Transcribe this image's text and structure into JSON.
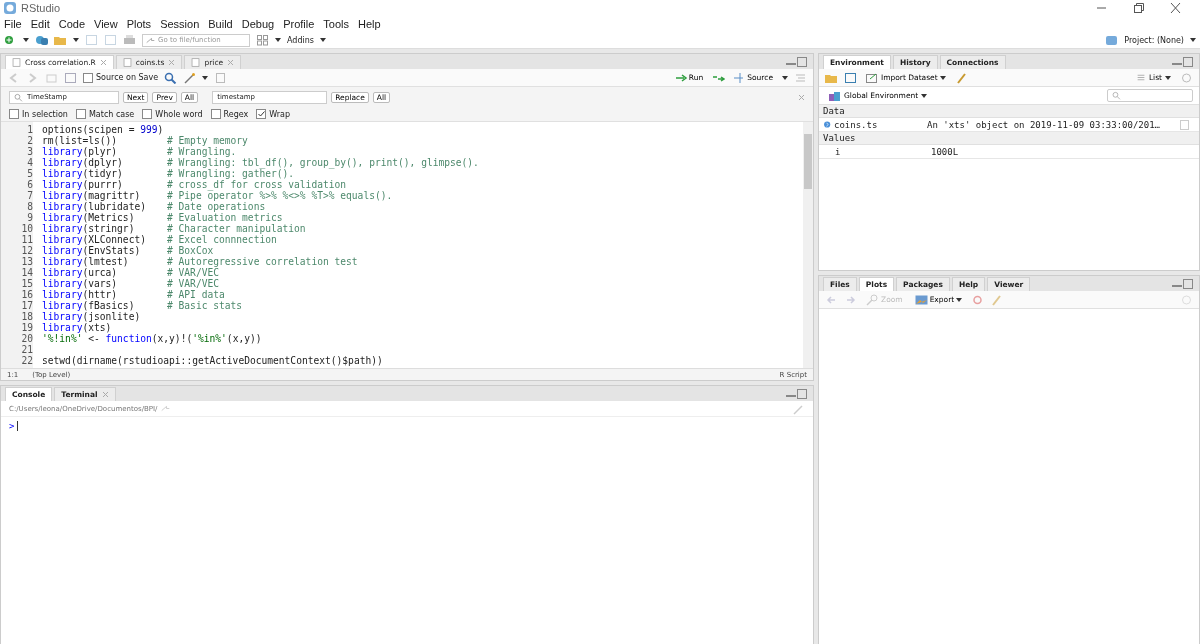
{
  "window": {
    "title": "RStudio"
  },
  "menu": [
    "File",
    "Edit",
    "Code",
    "View",
    "Plots",
    "Session",
    "Build",
    "Debug",
    "Profile",
    "Tools",
    "Help"
  ],
  "toolbar": {
    "goto_placeholder": "Go to file/function",
    "addins": "Addins",
    "project": "Project: (None)"
  },
  "source": {
    "tabs": [
      {
        "label": "Cross correlation.R",
        "selected": true
      },
      {
        "label": "coins.ts",
        "selected": false
      },
      {
        "label": "price",
        "selected": false
      }
    ],
    "source_on_save": {
      "label": "Source on Save",
      "checked": false
    },
    "run": "Run",
    "source_button": "Source",
    "find": {
      "value": "TimeStamp",
      "buttons": [
        "Next",
        "Prev",
        "All"
      ],
      "replace_value": "timestamp",
      "replace_buttons": [
        "Replace",
        "All"
      ]
    },
    "options": [
      {
        "label": "In selection",
        "checked": false
      },
      {
        "label": "Match case",
        "checked": false
      },
      {
        "label": "Whole word",
        "checked": false
      },
      {
        "label": "Regex",
        "checked": false
      },
      {
        "label": "Wrap",
        "checked": true
      }
    ],
    "lines": [
      {
        "number": "1",
        "code": [
          {
            "text": "options(scipen = ",
            "kind": "plain"
          },
          {
            "text": "999",
            "kind": "number"
          },
          {
            "text": ")",
            "kind": "plain"
          }
        ]
      },
      {
        "number": "2",
        "code": [
          {
            "text": "rm(list=ls())",
            "kind": "plain"
          }
        ],
        "comment": "# Empty memory"
      },
      {
        "number": "3",
        "code": [
          {
            "text": "library",
            "kind": "keyword"
          },
          {
            "text": "(plyr)",
            "kind": "plain"
          }
        ],
        "comment": "# Wrangling."
      },
      {
        "number": "4",
        "code": [
          {
            "text": "library",
            "kind": "keyword"
          },
          {
            "text": "(dplyr)",
            "kind": "plain"
          }
        ],
        "comment": "# Wrangling: tbl_df(), group_by(), print(), glimpse()."
      },
      {
        "number": "5",
        "code": [
          {
            "text": "library",
            "kind": "keyword"
          },
          {
            "text": "(tidyr)",
            "kind": "plain"
          }
        ],
        "comment": "# Wrangling: gather()."
      },
      {
        "number": "6",
        "code": [
          {
            "text": "library",
            "kind": "keyword"
          },
          {
            "text": "(purrr)",
            "kind": "plain"
          }
        ],
        "comment": "# cross_df for cross validation"
      },
      {
        "number": "7",
        "code": [
          {
            "text": "library",
            "kind": "keyword"
          },
          {
            "text": "(magrittr)",
            "kind": "plain"
          }
        ],
        "comment": "# Pipe operator %>% %<>% %T>% equals()."
      },
      {
        "number": "8",
        "code": [
          {
            "text": "library",
            "kind": "keyword"
          },
          {
            "text": "(lubridate)",
            "kind": "plain"
          }
        ],
        "comment": "# Date operations"
      },
      {
        "number": "9",
        "code": [
          {
            "text": "library",
            "kind": "keyword"
          },
          {
            "text": "(Metrics)",
            "kind": "plain"
          }
        ],
        "comment": "# Evaluation metrics"
      },
      {
        "number": "10",
        "code": [
          {
            "text": "library",
            "kind": "keyword"
          },
          {
            "text": "(stringr)",
            "kind": "plain"
          }
        ],
        "comment": "# Character manipulation"
      },
      {
        "number": "11",
        "code": [
          {
            "text": "library",
            "kind": "keyword"
          },
          {
            "text": "(XLConnect)",
            "kind": "plain"
          }
        ],
        "comment": "# Excel connnection"
      },
      {
        "number": "12",
        "code": [
          {
            "text": "library",
            "kind": "keyword"
          },
          {
            "text": "(EnvStats)",
            "kind": "plain"
          }
        ],
        "comment": "# BoxCox"
      },
      {
        "number": "13",
        "code": [
          {
            "text": "library",
            "kind": "keyword"
          },
          {
            "text": "(lmtest)",
            "kind": "plain"
          }
        ],
        "comment": "# Autoregressive correlation test"
      },
      {
        "number": "14",
        "code": [
          {
            "text": "library",
            "kind": "keyword"
          },
          {
            "text": "(urca)",
            "kind": "plain"
          }
        ],
        "comment": "# VAR/VEC"
      },
      {
        "number": "15",
        "code": [
          {
            "text": "library",
            "kind": "keyword"
          },
          {
            "text": "(vars)",
            "kind": "plain"
          }
        ],
        "comment": "# VAR/VEC"
      },
      {
        "number": "16",
        "code": [
          {
            "text": "library",
            "kind": "keyword"
          },
          {
            "text": "(httr)",
            "kind": "plain"
          }
        ],
        "comment": "# API data"
      },
      {
        "number": "17",
        "code": [
          {
            "text": "library",
            "kind": "keyword"
          },
          {
            "text": "(fBasics)",
            "kind": "plain"
          }
        ],
        "comment": "# Basic stats"
      },
      {
        "number": "18",
        "code": [
          {
            "text": "library",
            "kind": "keyword"
          },
          {
            "text": "(jsonlite)",
            "kind": "plain"
          }
        ]
      },
      {
        "number": "19",
        "code": [
          {
            "text": "library",
            "kind": "keyword"
          },
          {
            "text": "(xts)",
            "kind": "plain"
          }
        ]
      },
      {
        "number": "20",
        "code": [
          {
            "text": "'%!in%'",
            "kind": "string"
          },
          {
            "text": " <- ",
            "kind": "plain"
          },
          {
            "text": "function",
            "kind": "keyword"
          },
          {
            "text": "(x,y)!(",
            "kind": "plain"
          },
          {
            "text": "'%in%'",
            "kind": "string"
          },
          {
            "text": "(x,y))",
            "kind": "plain"
          }
        ]
      },
      {
        "number": "21"
      },
      {
        "number": "22",
        "code": [
          {
            "text": "setwd(dirname(rstudioapi::getActiveDocumentContext()$path))",
            "kind": "plain"
          }
        ]
      }
    ],
    "status": {
      "position": "1:1",
      "scope": "(Top Level)",
      "filetype": "R Script"
    }
  },
  "console": {
    "tabs": [
      {
        "label": "Console",
        "selected": true
      },
      {
        "label": "Terminal",
        "selected": false
      }
    ],
    "path": "C:/Users/leona/OneDrive/Documentos/BPI/",
    "prompt": ">"
  },
  "environment": {
    "tabs": [
      {
        "label": "Environment",
        "selected": true
      },
      {
        "label": "History",
        "selected": false
      },
      {
        "label": "Connections",
        "selected": false
      }
    ],
    "import": "Import Dataset",
    "view": "List",
    "scope": "Global Environment",
    "sections": [
      {
        "title": "Data",
        "rows": [
          {
            "name": "coins.ts",
            "value": "An 'xts' object on 2019-11-09 03:33:00/201…",
            "kind": "data"
          }
        ]
      },
      {
        "title": "Values",
        "rows": [
          {
            "name": "i",
            "value": "1000L",
            "kind": "value"
          }
        ]
      }
    ]
  },
  "files": {
    "tabs": [
      {
        "label": "Files",
        "selected": false
      },
      {
        "label": "Plots",
        "selected": true
      },
      {
        "label": "Packages",
        "selected": false
      },
      {
        "label": "Help",
        "selected": false
      },
      {
        "label": "Viewer",
        "selected": false
      }
    ],
    "zoom": {
      "label": "Zoom",
      "disabled": true
    },
    "export": "Export"
  }
}
